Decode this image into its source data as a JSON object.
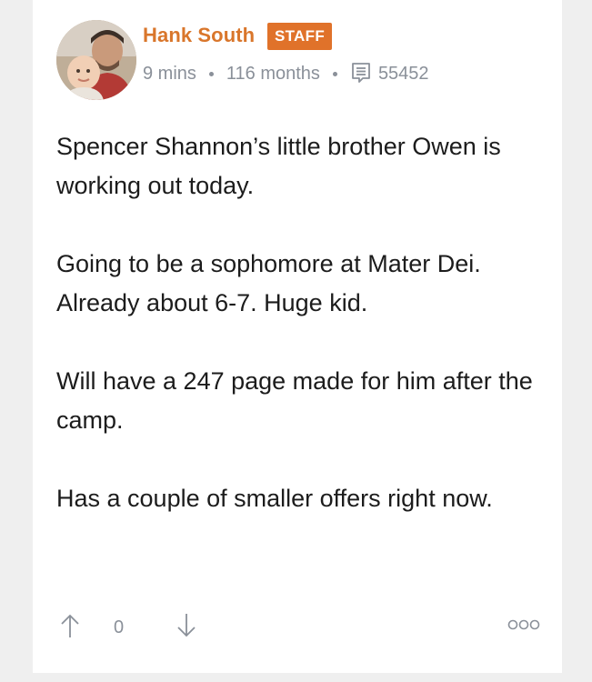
{
  "post": {
    "author": "Hank South",
    "badge": "STAFF",
    "time_ago": "9 mins",
    "membership": "116 months",
    "comment_count": "55452",
    "paragraphs": [
      "Spencer Shannon’s little brother Owen is working out today.",
      "Going to be a sophomore at Mater Dei. Already about 6-7. Huge kid.",
      "Will have a 247 page made for him after the camp.",
      "Has a couple of smaller offers right now."
    ],
    "vote_count": "0"
  },
  "colors": {
    "author": "#d9762b",
    "badge_bg": "#e0722a",
    "meta": "#8a9099",
    "text": "#1c1c1c"
  },
  "icons": {
    "comment": "comment-list-icon",
    "up": "arrow-up-icon",
    "down": "arrow-down-icon",
    "more": "more-options-icon"
  }
}
